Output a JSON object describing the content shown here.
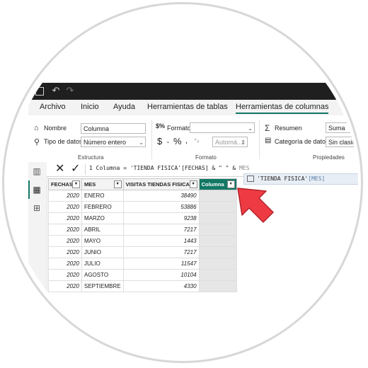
{
  "ribbon_tabs": [
    "Archivo",
    "Inicio",
    "Ayuda",
    "Herramientas de tablas",
    "Herramientas de columnas"
  ],
  "structure": {
    "name_label": "Nombre",
    "name_value": "Columna",
    "datatype_label": "Tipo de datos",
    "datatype_value": "Número entero",
    "group_title": "Estructura"
  },
  "format": {
    "format_label": "Formato",
    "format_value": "",
    "currency_symbol": "$",
    "percent_symbol": "%",
    "decimal_symbol": ",",
    "auto_value": "Automá...",
    "group_title": "Formato"
  },
  "properties": {
    "summary_label": "Resumen",
    "summary_value": "Suma",
    "category_label": "Categoría de datos",
    "category_value": "Sin clasifica",
    "group_title": "Propiedades"
  },
  "formula_bar": {
    "cancel": "✕",
    "commit": "✓",
    "line_no": "1",
    "formula": "Columna = 'TIENDA FISICA'[FECHAS] & \" \" & ",
    "typed": "MES"
  },
  "autocomplete": {
    "suggestion_table": "'TIENDA FISICA'",
    "suggestion_column": "[MES]"
  },
  "table": {
    "columns": [
      "FECHAS",
      "MES",
      "VISITAS TIENDAS FISICAS",
      "Columna"
    ],
    "rows": [
      [
        "2020",
        "ENERO",
        "38490"
      ],
      [
        "2020",
        "FEBRERO",
        "53886"
      ],
      [
        "2020",
        "MARZO",
        "9238"
      ],
      [
        "2020",
        "ABRIL",
        "7217"
      ],
      [
        "2020",
        "MAYO",
        "1443"
      ],
      [
        "2020",
        "JUNIO",
        "7217"
      ],
      [
        "2020",
        "JULIO",
        "11547"
      ],
      [
        "2020",
        "AGOSTO",
        "10104"
      ],
      [
        "2020",
        "SEPTIEMBRE",
        "4330"
      ]
    ]
  },
  "colors": {
    "accent": "#117865",
    "arrow": "#ee3b43",
    "titlebar": "#1f1f1f"
  }
}
